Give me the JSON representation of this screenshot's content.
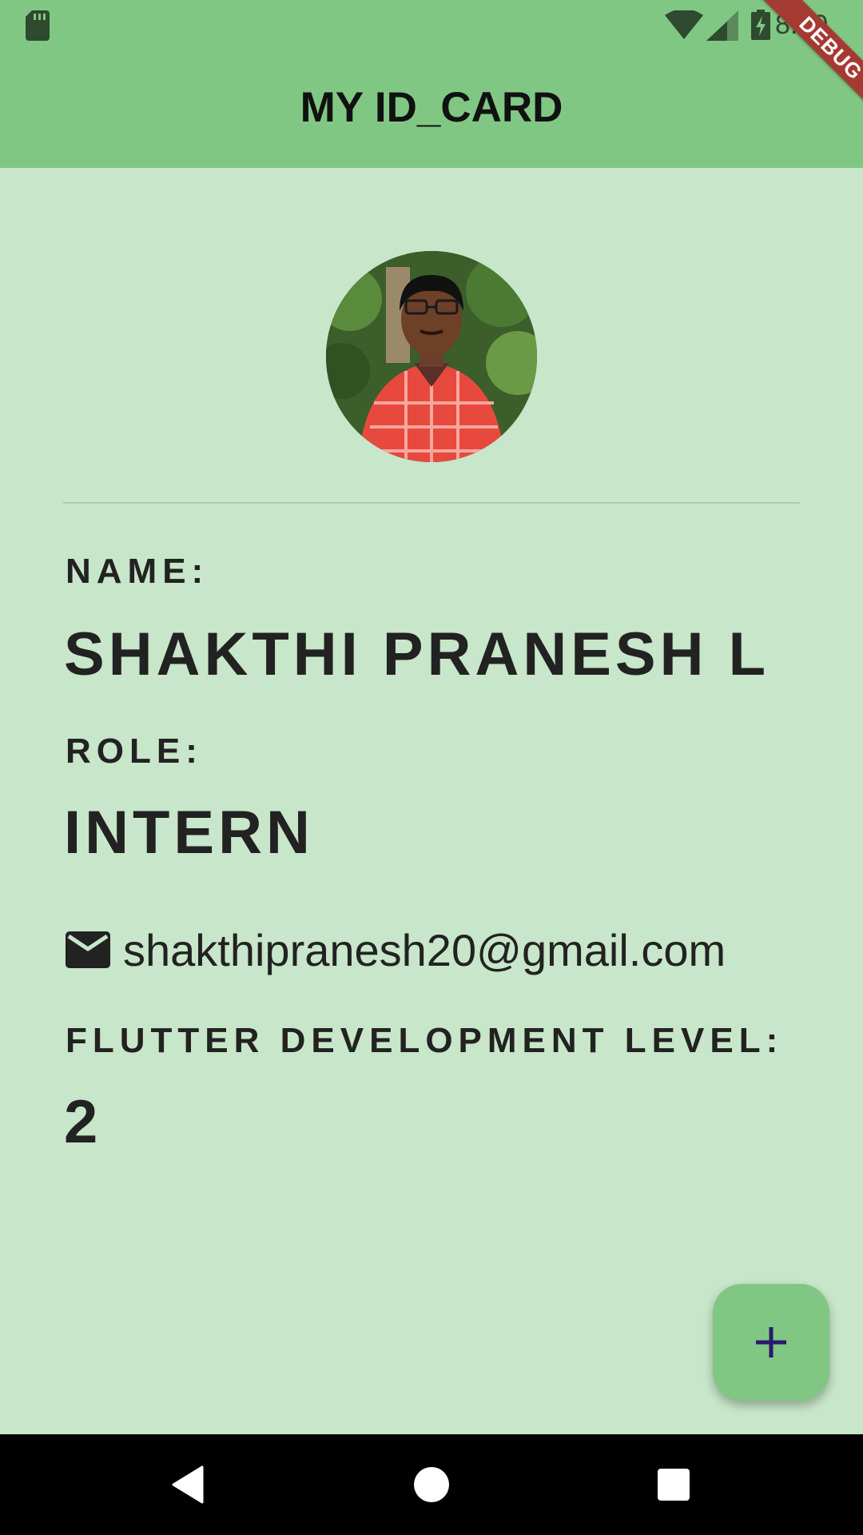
{
  "status_bar": {
    "time": "8:00",
    "icons": [
      "sd-card-icon",
      "wifi-icon",
      "signal-icon",
      "battery-charging-icon"
    ]
  },
  "app_bar": {
    "title": "MY ID_CARD"
  },
  "debug_banner": {
    "label": "DEBUG"
  },
  "profile": {
    "avatar_description": "person in red checked shirt with glasses"
  },
  "fields": {
    "name_label": "NAME:",
    "name_value": "SHAKTHI PRANESH L",
    "role_label": "ROLE:",
    "role_value": "INTERN",
    "email": "shakthipranesh20@gmail.com",
    "email_icon": "mail-icon",
    "level_label": "FLUTTER DEVELOPMENT LEVEL:",
    "level_value": "2"
  },
  "fab": {
    "icon": "plus-icon"
  },
  "nav_bar": {
    "buttons": [
      "back-icon",
      "home-icon",
      "recents-icon"
    ]
  },
  "colors": {
    "background": "#c8e6c9",
    "app_bar": "#81c784",
    "text": "#212121",
    "debug_banner": "#a53a32",
    "fab_icon": "#2b1a6b"
  }
}
